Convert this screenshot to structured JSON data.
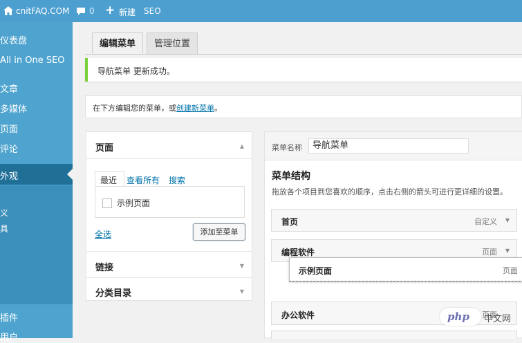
{
  "adminbar": {
    "site": "cnitFAQ.COM",
    "comments": "0",
    "new": "新建",
    "seo": "SEO"
  },
  "sidebar": {
    "items": [
      "仪表盘",
      "All in One SEO",
      "文章",
      "多媒体",
      "页面",
      "评论",
      "外观"
    ],
    "sub": [
      "义",
      "具"
    ],
    "bottom": [
      "插件",
      "用户"
    ]
  },
  "tabs": {
    "edit": "编辑菜单",
    "locations": "管理位置"
  },
  "notice": "导航菜单 更新成功。",
  "manage": {
    "prefix": "在下方编辑您的菜单，或",
    "link": "创建新菜单",
    "suffix": "。"
  },
  "left": {
    "pages_title": "页面",
    "tabs": [
      "最近",
      "查看所有",
      "搜索"
    ],
    "example_page": "示例页面",
    "select_all": "全选",
    "add_button": "添加至菜单",
    "links_title": "链接",
    "categories_title": "分类目录"
  },
  "right": {
    "name_label": "菜单名称",
    "name_value": "导航菜单",
    "structure_title": "菜单结构",
    "structure_desc": "拖放各个项目到您喜欢的顺序，点击右侧的箭头可进行更详细的设置。",
    "items": [
      {
        "label": "首页",
        "type": "自定义"
      },
      {
        "label": "编程软件",
        "type": "页面"
      },
      {
        "label": "示例页面",
        "type": "页面"
      },
      {
        "label": "办公软件",
        "type": "页面"
      }
    ]
  },
  "watermark": {
    "logo": "php",
    "text": "中文网"
  },
  "colors": {
    "adminbar": "#4d9fd0",
    "sidebar": "#4fa4cf",
    "active": "#1f6f97",
    "link": "#0073aa",
    "success": "#7ad03a"
  }
}
